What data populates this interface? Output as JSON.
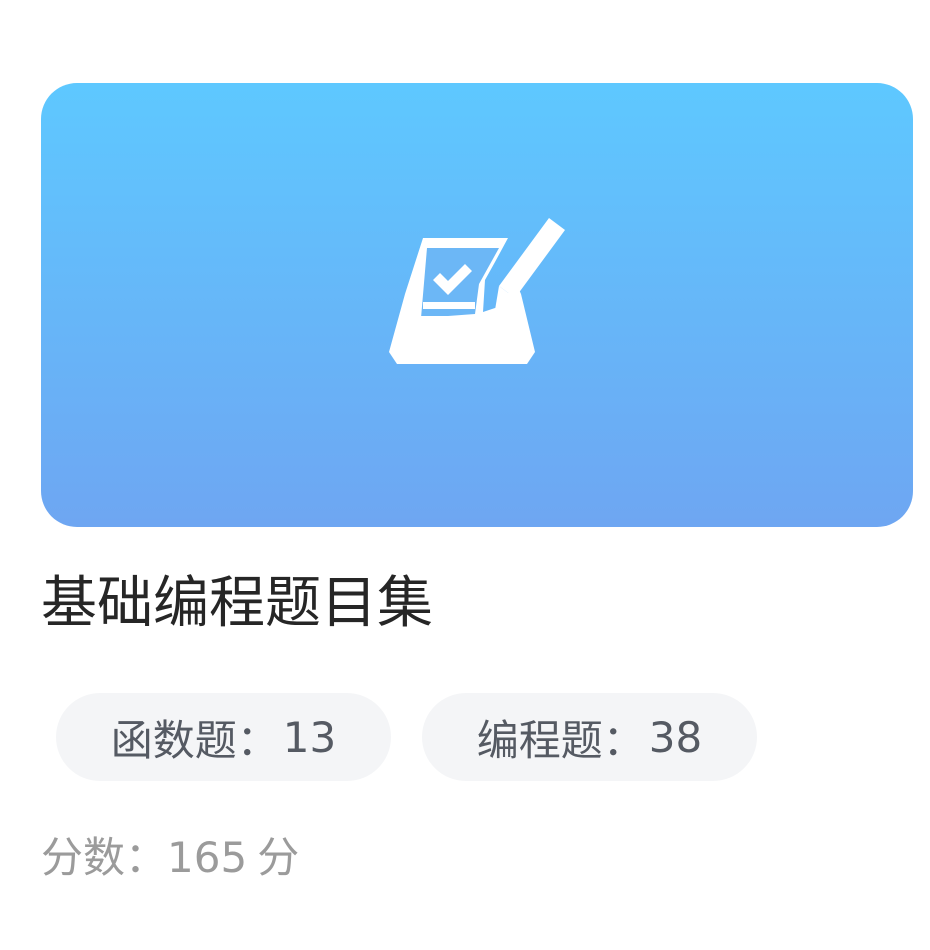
{
  "card": {
    "icon": "exam-paper-pencil-icon",
    "title": "基础编程题目集",
    "tags": [
      {
        "label": "函数题",
        "separator": "：",
        "count": "13"
      },
      {
        "label": "编程题",
        "separator": "：",
        "count": "38"
      }
    ],
    "score": {
      "label": "分数",
      "separator": "：",
      "value": "165",
      "unit": "分"
    }
  },
  "colors": {
    "banner_top": "#5ec8ff",
    "banner_bottom": "#6ea6f2",
    "icon": "#ffffff",
    "title_text": "#262626",
    "tag_background": "#f4f5f7",
    "tag_text": "#555a63",
    "score_text": "#9b9b9b"
  }
}
